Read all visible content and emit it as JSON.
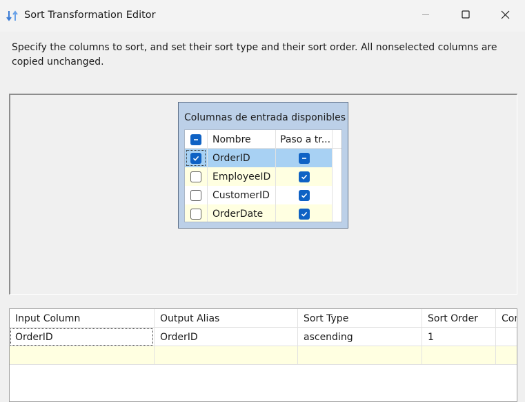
{
  "window": {
    "title": "Sort Transformation Editor",
    "icon": "sort-arrows-icon",
    "controls": [
      "minimize-icon",
      "maximize-icon",
      "close-icon"
    ]
  },
  "description": "Specify the columns to sort, and set their sort type and their sort order. All nonselected columns are copied unchanged.",
  "input_panel": {
    "title": "Columnas de entrada disponibles",
    "headers": {
      "name": "Nombre",
      "pass": "Paso a tr..."
    },
    "header_checkbox": "indeterminate",
    "rows": [
      {
        "name": "OrderID",
        "selected": true,
        "pass": "indeterminate"
      },
      {
        "name": "EmployeeID",
        "selected": false,
        "pass": "checked"
      },
      {
        "name": "CustomerID",
        "selected": false,
        "pass": "checked"
      },
      {
        "name": "OrderDate",
        "selected": false,
        "pass": "checked"
      }
    ]
  },
  "sort_grid": {
    "headers": [
      "Input Column",
      "Output Alias",
      "Sort Type",
      "Sort Order",
      "Com"
    ],
    "rows": [
      [
        "OrderID",
        "OrderID",
        "ascending",
        "1",
        ""
      ]
    ]
  },
  "colors": {
    "accent": "#0f62c4",
    "selected_row": "#a8d1f3",
    "alt_row": "#ffffe1",
    "panel_bg": "#bcd0e8"
  }
}
